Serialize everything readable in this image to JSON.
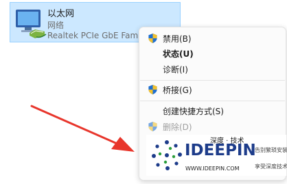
{
  "adapter": {
    "name": "以太网",
    "type": "网络",
    "device": "Realtek PCIe GbE Fami",
    "icon": "network-adapter-icon"
  },
  "context_menu": {
    "items": [
      {
        "label": "禁用(B)",
        "icon": "uac-shield-icon"
      },
      {
        "label": "状态(U)"
      },
      {
        "label": "诊断(I)"
      },
      {
        "label": "桥接(G)",
        "icon": "uac-shield-icon"
      },
      {
        "label": "创建快捷方式(S)"
      },
      {
        "label": "删除(D)",
        "icon": "uac-shield-icon",
        "disabled": true
      }
    ]
  },
  "watermark": {
    "brand": "IDEEPIN",
    "cn_title": "深度 · 技术",
    "url": "WWW.IDEEPIN.COM",
    "slogan_1": "告别繁琐安装",
    "slogan_2": "享受深度技术"
  },
  "colors": {
    "selection": "#cce8ff",
    "arrow": "#e8362c",
    "brand": "#1d3c8a"
  }
}
